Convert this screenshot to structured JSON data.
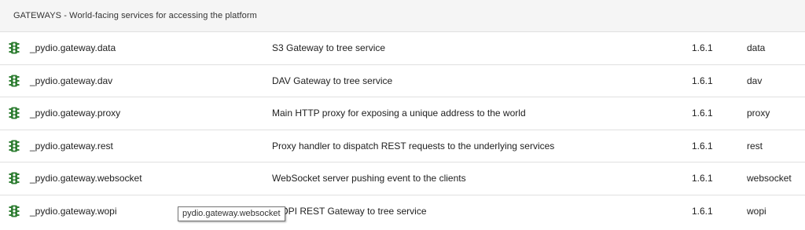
{
  "group": {
    "title": "GATEWAYS - World-facing services for accessing the platform"
  },
  "icon": "traffic-light-icon",
  "status_color": "#2e7d32",
  "services": [
    {
      "name": "_pydio.gateway.data",
      "description": "S3 Gateway to tree service",
      "version": "1.6.1",
      "tag": "data"
    },
    {
      "name": "_pydio.gateway.dav",
      "description": "DAV Gateway to tree service",
      "version": "1.6.1",
      "tag": "dav"
    },
    {
      "name": "_pydio.gateway.proxy",
      "description": "Main HTTP proxy for exposing a unique address to the world",
      "version": "1.6.1",
      "tag": "proxy"
    },
    {
      "name": "_pydio.gateway.rest",
      "description": "Proxy handler to dispatch REST requests to the underlying services",
      "version": "1.6.1",
      "tag": "rest"
    },
    {
      "name": "_pydio.gateway.websocket",
      "description": "WebSocket server pushing event to the clients",
      "version": "1.6.1",
      "tag": "websocket"
    },
    {
      "name": "_pydio.gateway.wopi",
      "description": "WOPI REST Gateway to tree service",
      "version": "1.6.1",
      "tag": "wopi"
    }
  ],
  "tooltip": {
    "text": "pydio.gateway.websocket"
  }
}
